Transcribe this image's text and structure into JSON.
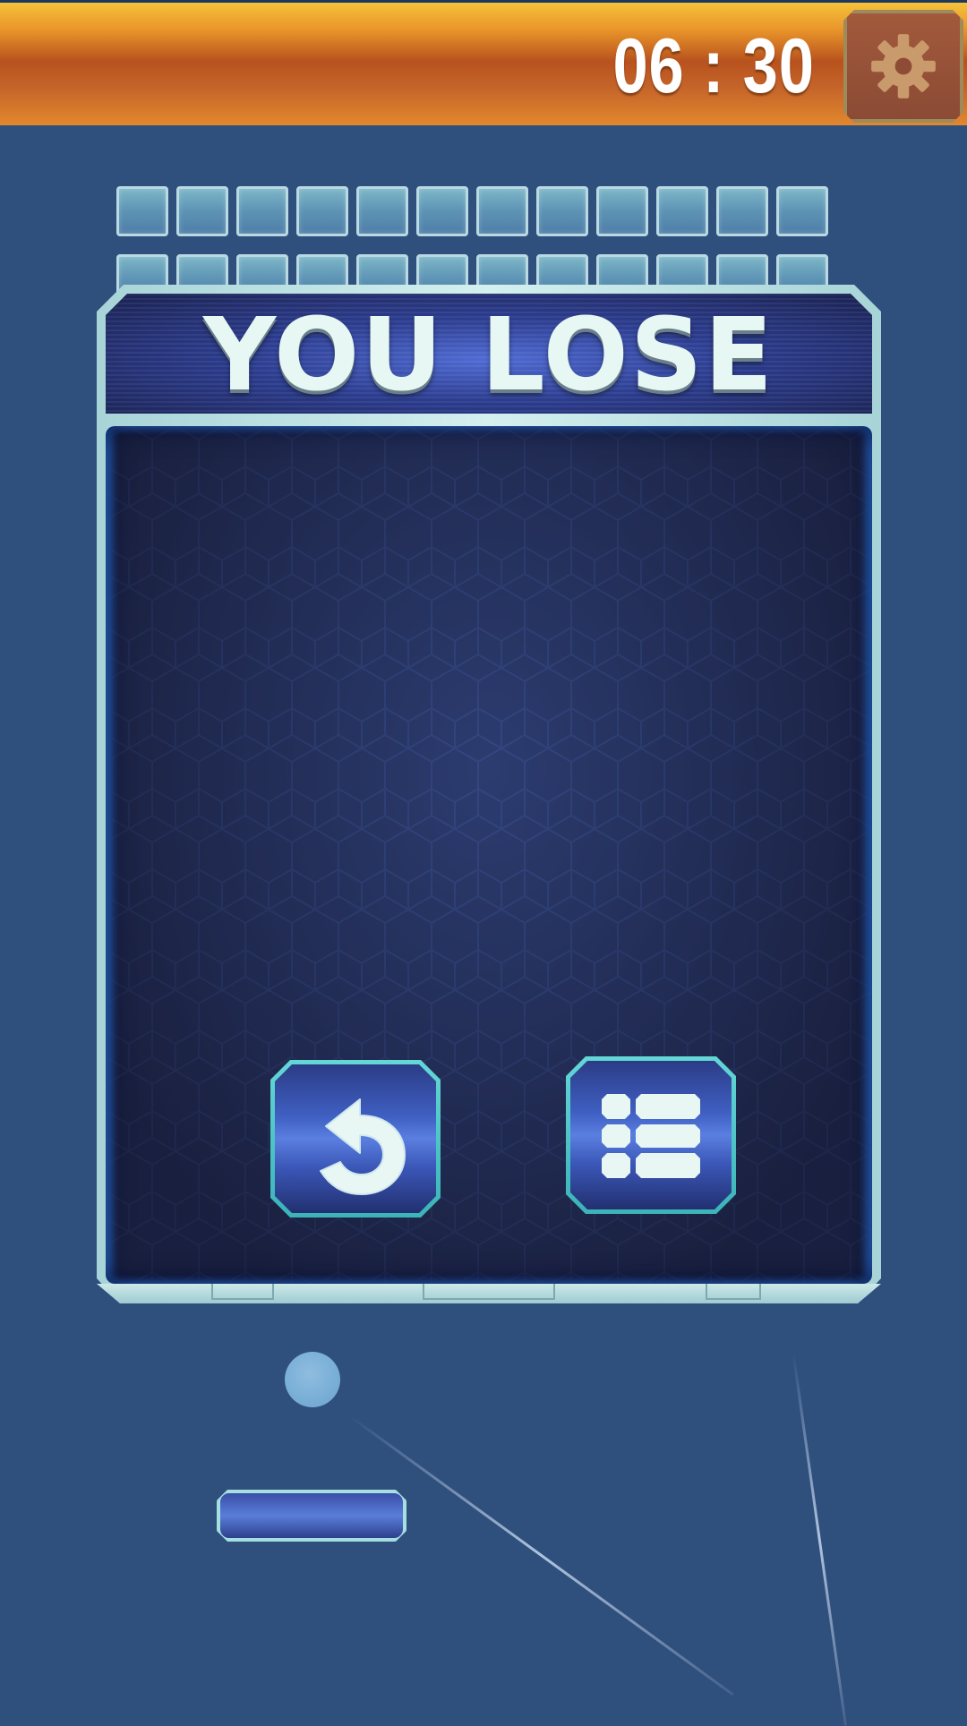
{
  "hud": {
    "timer": "06 : 30",
    "settings_icon": "gear-icon"
  },
  "dialog": {
    "title": "YOU LOSE",
    "buttons": [
      {
        "name": "restart",
        "icon": "restart-arrow-icon"
      },
      {
        "name": "level-menu",
        "icon": "list-menu-icon"
      }
    ]
  },
  "bricks": {
    "rows": 2,
    "columns": 12
  },
  "colors": {
    "background": "#2f4f7d",
    "topbar_accent": "#e9952a",
    "brick_fill": "#6aa2bf",
    "button_border": "#4fc8cc"
  }
}
